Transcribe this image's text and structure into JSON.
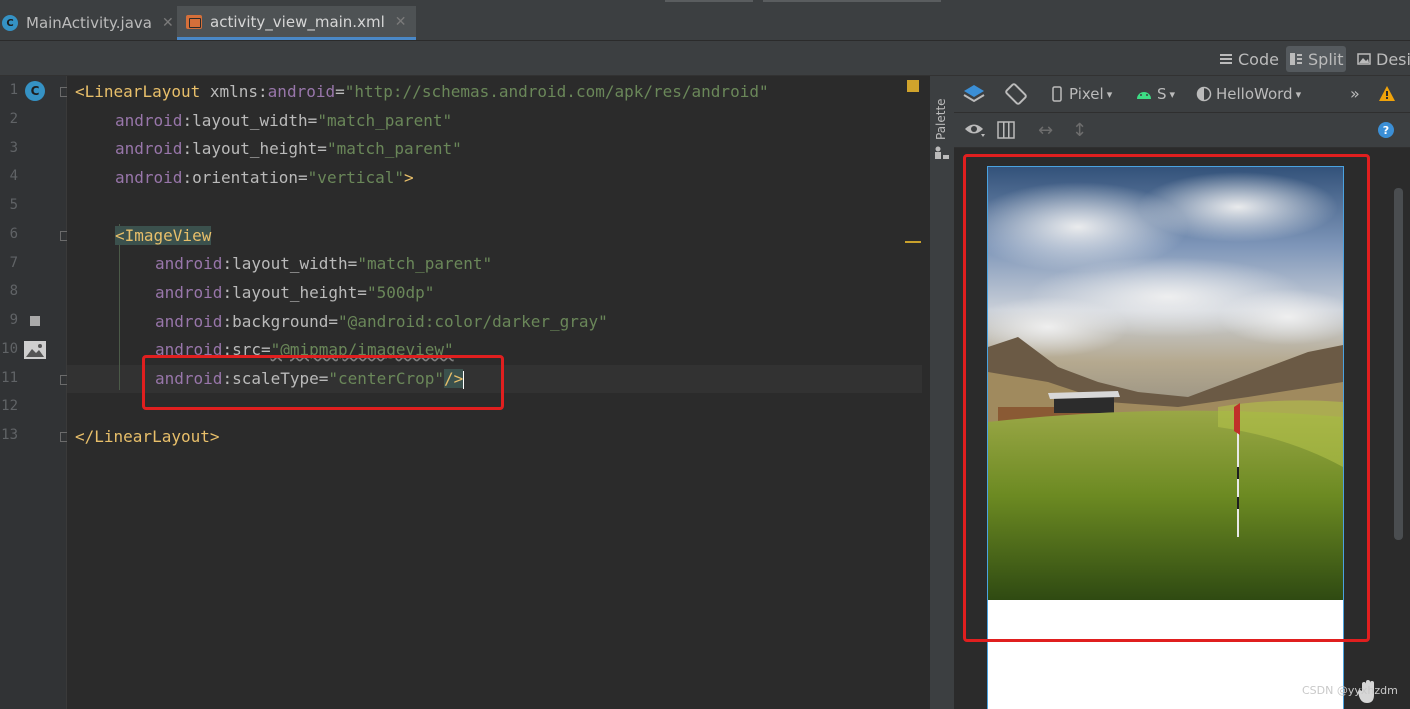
{
  "tabs": [
    {
      "label": "MainActivity.java",
      "icon": "java-class-icon",
      "active": false
    },
    {
      "label": "activity_view_main.xml",
      "icon": "xml-file-icon",
      "active": true
    }
  ],
  "view_modes": {
    "code": "Code",
    "split": "Split",
    "design": "Desig"
  },
  "line_numbers": [
    "1",
    "2",
    "3",
    "4",
    "5",
    "6",
    "7",
    "8",
    "9",
    "10",
    "11",
    "12",
    "13"
  ],
  "code_lines": {
    "l1": {
      "open": "<",
      "tag": "LinearLayout",
      "attr": " xmlns",
      "colon": ":",
      "ns": "android",
      "eq": "=",
      "val": "\"http://schemas.android.com/apk/res/android\""
    },
    "l2": {
      "ns": "android",
      "attr": ":layout_width",
      "eq": "=",
      "val": "\"match_parent\""
    },
    "l3": {
      "ns": "android",
      "attr": ":layout_height",
      "eq": "=",
      "val": "\"match_parent\""
    },
    "l4": {
      "ns": "android",
      "attr": ":orientation",
      "eq": "=",
      "val": "\"vertical\"",
      "close": ">"
    },
    "l6": {
      "tag": "<ImageView"
    },
    "l7": {
      "ns": "android",
      "attr": ":layout_width",
      "eq": "=",
      "val": "\"match_parent\""
    },
    "l8": {
      "ns": "android",
      "attr": ":layout_height",
      "eq": "=",
      "val": "\"500dp\""
    },
    "l9": {
      "ns": "android",
      "attr": ":background",
      "eq": "=",
      "val": "\"@android:color/darker_gray\""
    },
    "l10": {
      "ns": "android",
      "attr": ":src",
      "eq": "=",
      "val": "\"@mipmap/imageview\""
    },
    "l11": {
      "ns": "android",
      "attr": ":scaleType",
      "eq": "=",
      "val": "\"centerCrop\"",
      "close": "/>"
    },
    "l13": {
      "tag": "</LinearLayout>"
    }
  },
  "palette_label": "Palette",
  "design_toolbar": {
    "device": "Pixel",
    "api": "S",
    "theme": "HelloWord"
  },
  "watermark": "CSDN @yyxhzdm",
  "colors": {
    "accent_blue": "#4a88c7",
    "highlight_red": "#e01f1f",
    "tag_yellow": "#e8bf6a",
    "value_green": "#6a8759",
    "ns_purple": "#9876aa"
  }
}
